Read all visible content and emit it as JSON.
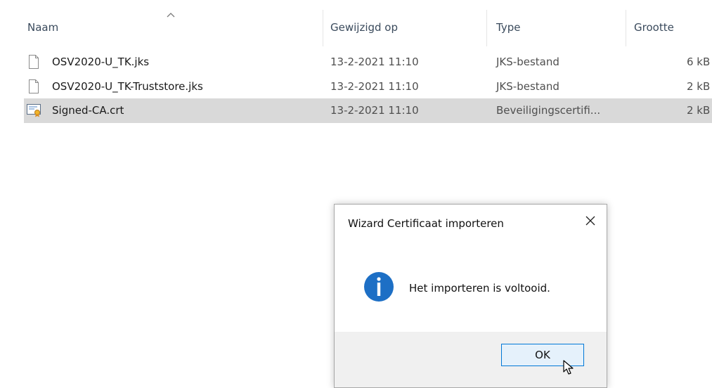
{
  "columns": {
    "name": "Naam",
    "modified": "Gewijzigd op",
    "type": "Type",
    "size": "Grootte"
  },
  "files": [
    {
      "name": "OSV2020-U_TK.jks",
      "modified": "13-2-2021 11:10",
      "type": "JKS-bestand",
      "size": "6 kB",
      "icon": "document-icon",
      "selected": false
    },
    {
      "name": "OSV2020-U_TK-Truststore.jks",
      "modified": "13-2-2021 11:10",
      "type": "JKS-bestand",
      "size": "2 kB",
      "icon": "document-icon",
      "selected": false
    },
    {
      "name": "Signed-CA.crt",
      "modified": "13-2-2021 11:10",
      "type": "Beveiligingscertifi...",
      "size": "2 kB",
      "icon": "certificate-icon",
      "selected": true
    }
  ],
  "dialog": {
    "title": "Wizard Certificaat importeren",
    "message": "Het importeren is voltooid.",
    "ok_label": "OK",
    "icon": "info-icon"
  },
  "colors": {
    "selection": "#d9d9d9",
    "info_blue": "#1d6fc5",
    "button_border": "#0078d7",
    "button_fill": "#e5f1fb",
    "dialog_footer": "#f0f0f0"
  }
}
